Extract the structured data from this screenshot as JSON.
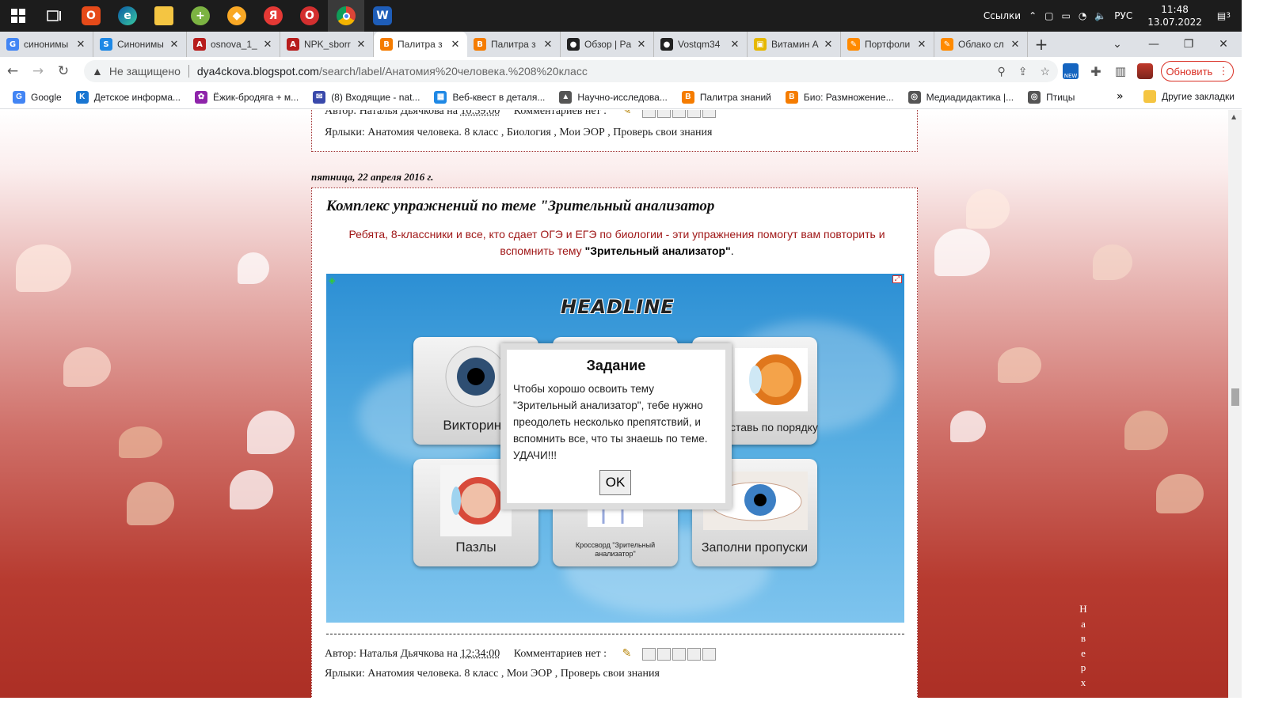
{
  "taskbar": {
    "tray_label": "Ссылки",
    "lang": "РУС",
    "time": "11:48",
    "date": "13.07.2022",
    "notif_count": "3",
    "icons": [
      "windows-start-icon",
      "task-view-icon",
      "office-icon",
      "edge-icon",
      "file-explorer-icon",
      "plus-app-icon",
      "shield-browser-icon",
      "yandex-icon",
      "opera-icon",
      "chrome-icon",
      "word-icon"
    ]
  },
  "tabs": [
    {
      "title": "синонимы",
      "icon": "G",
      "color": "#4285f4"
    },
    {
      "title": "Синонимы",
      "icon": "S",
      "color": "#1e88e5"
    },
    {
      "title": "osnova_1_",
      "icon": "A",
      "color": "#b71c1c"
    },
    {
      "title": "NPK_sborr",
      "icon": "A",
      "color": "#b71c1c"
    },
    {
      "title": "Палитра з",
      "icon": "B",
      "color": "#f57c00"
    },
    {
      "title": "Палитра з",
      "icon": "B",
      "color": "#f57c00"
    },
    {
      "title": "Обзор | Pa",
      "icon": "●",
      "color": "#222"
    },
    {
      "title": "Vostqm34",
      "icon": "●",
      "color": "#222"
    },
    {
      "title": "Витамин А",
      "icon": "▣",
      "color": "#e6b800"
    },
    {
      "title": "Портфоли",
      "icon": "✎",
      "color": "#ff8a00"
    },
    {
      "title": "Облако сл",
      "icon": "✎",
      "color": "#ff8a00"
    }
  ],
  "address": {
    "security": "Не защищено",
    "host": "dya4ckova.blogspot.com",
    "path": "/search/label/Анатомия%20человека.%208%20класс",
    "update_label": "Обновить"
  },
  "bookmarks": [
    {
      "label": "Google",
      "icon": "G",
      "color": "#4285f4"
    },
    {
      "label": "Детское информа...",
      "icon": "K",
      "color": "#1976d2"
    },
    {
      "label": "Ёжик-бродяга + м...",
      "icon": "✿",
      "color": "#8e24aa"
    },
    {
      "label": "(8) Входящие - nat...",
      "icon": "✉",
      "color": "#3949ab"
    },
    {
      "label": "Веб-квест в деталя...",
      "icon": "▦",
      "color": "#1e88e5"
    },
    {
      "label": "Научно-исследова...",
      "icon": "▲",
      "color": "#555"
    },
    {
      "label": "Палитра знаний",
      "icon": "B",
      "color": "#f57c00"
    },
    {
      "label": "Био: Размножение...",
      "icon": "B",
      "color": "#f57c00"
    },
    {
      "label": "Медиадидактика |...",
      "icon": "◎",
      "color": "#555"
    },
    {
      "label": "Птицы",
      "icon": "◎",
      "color": "#555"
    }
  ],
  "bookmarks_more": "»",
  "bookmarks_other": "Другие закладки",
  "post1": {
    "author_line": "Автор: Наталья Дьячкова на",
    "time": "10:59:00",
    "comments": "Комментариев нет :",
    "labels_prefix": "Ярлыки:",
    "labels": "Анатомия человека. 8 класс , Биология , Мои ЭОР , Проверь свои знания"
  },
  "post2": {
    "date": "пятница, 22 апреля 2016 г.",
    "title": "Комплекс упражнений по теме \"Зрительный анализатор",
    "intro_line1": "Ребята, 8-классники и все, кто сдает ОГЭ и ЕГЭ по биологии -  эти упражнения помогут вам повторить и",
    "intro_line2": "вспомнить тему ",
    "intro_bold": "\"Зрительный анализатор\"",
    "intro_end": ".",
    "author_line": "Автор: Наталья Дьячкова на",
    "time": "12:34:00",
    "comments": "Комментариев нет :",
    "labels_prefix": "Ярлыки:",
    "labels": "Анатомия человека. 8 класс , Мои ЭОР , Проверь свои знания"
  },
  "app": {
    "headline": "HEADLINE",
    "cards": [
      "Викторина",
      "",
      "ставь по порядку",
      "Пазлы",
      "Кроссворд \"Зрительный анализатор\"",
      "Заполни пропуски"
    ],
    "dialog_title": "Задание",
    "dialog_text": "Чтобы хорошо освоить тему \"Зрительный анализатор\", тебе нужно преодолеть несколько препятствий, и вспомнить все, что ты знаешь по теме. УДАЧИ!!!",
    "ok_label": "OK"
  },
  "scroll_top_label": "Наверх"
}
